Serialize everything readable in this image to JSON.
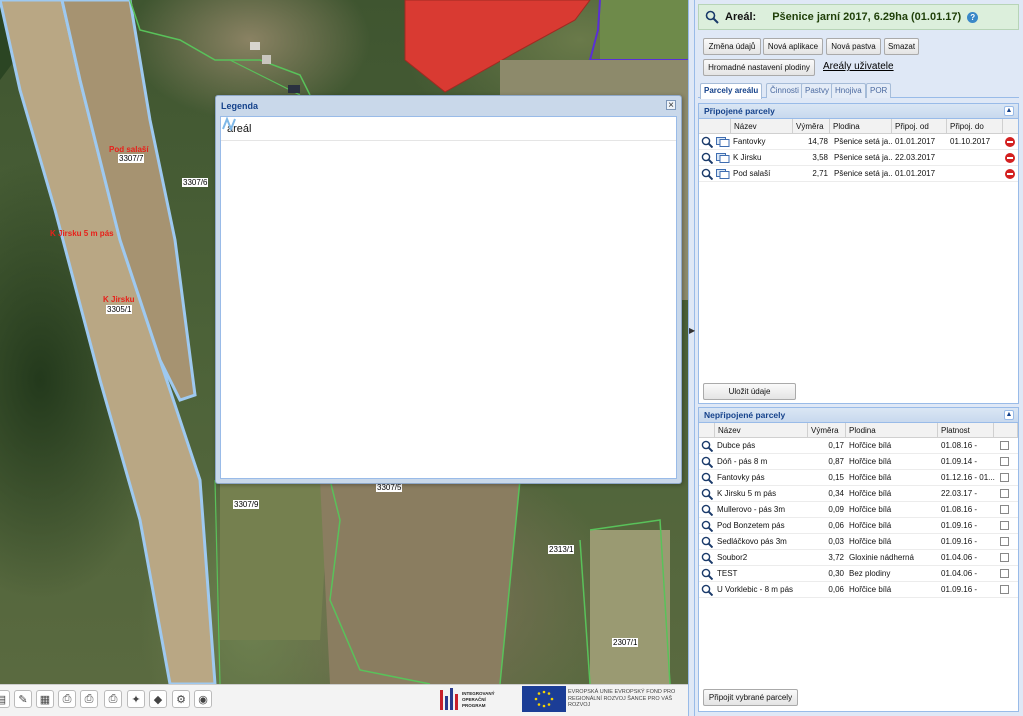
{
  "map": {
    "parcel_labels": [
      {
        "text": "Pod salaší"
      },
      {
        "text": "K Jirsku 5 m pás"
      },
      {
        "text": "K Jirsku"
      }
    ],
    "parcel_numbers": [
      "3307/7",
      "3307/6",
      "3305/1",
      "3307/9",
      "3307/5",
      "2313/1",
      "2307/1"
    ],
    "colors": {
      "red_area": "#d93a32",
      "parcel_outline": "#9ec9f0",
      "green_outline": "#59c25a",
      "purple_outline": "#5a2fd6"
    }
  },
  "legend": {
    "title": "Legenda",
    "close_icon": "close-icon",
    "items": [
      {
        "label": "areál",
        "icon": "areal-line-icon"
      }
    ]
  },
  "toolbar": {
    "icons": [
      "print-icon",
      "edit-icon",
      "layers-icon",
      "print-icon",
      "print-icon",
      "print-icon",
      "wizard-icon",
      "color-icon",
      "gear-icon",
      "eye-icon"
    ]
  },
  "logos": {
    "iop_text": "INTEGROVANÝ OPERAČNÍ PROGRAM",
    "eu_text": "EVROPSKÁ UNIE EVROPSKÝ FOND PRO REGIONÁLNÍ ROZVOJ ŠANCE PRO VÁŠ ROZVOJ"
  },
  "panel": {
    "header": {
      "label": "Areál:",
      "value": "Pšenice jarní 2017, 6.29ha (01.01.17)"
    },
    "buttons": {
      "change": "Změna údajů",
      "new_app": "Nová aplikace",
      "new_pastva": "Nová pastva",
      "delete": "Smazat",
      "bulk": "Hromadné nastavení plodiny",
      "arealy_link": "Areály uživatele"
    },
    "tabs": [
      "Parcely areálu",
      "Činnosti",
      "Pastvy",
      "Hnojiva",
      "POR"
    ],
    "active_tab": "Parcely areálu",
    "attached": {
      "title": "Připojené parcely",
      "columns": [
        "Název",
        "Výměra",
        "Plodina",
        "Připoj. od",
        "Připoj. do"
      ],
      "rows": [
        {
          "name": "Fantovky",
          "area": "14,78",
          "crop": "Pšenice setá ja...",
          "from": "01.01.2017",
          "to": "01.10.2017"
        },
        {
          "name": "K Jirsku",
          "area": "3,58",
          "crop": "Pšenice setá ja...",
          "from": "22.03.2017",
          "to": ""
        },
        {
          "name": "Pod salaší",
          "area": "2,71",
          "crop": "Pšenice setá ja...",
          "from": "01.01.2017",
          "to": ""
        }
      ],
      "save_label": "Uložit údaje"
    },
    "unattached": {
      "title": "Nepřipojené parcely",
      "columns": [
        "Název",
        "Výměra",
        "Plodina",
        "Platnost"
      ],
      "rows": [
        {
          "name": "Dubce pás",
          "area": "0,17",
          "crop": "Hořčice bílá",
          "valid": "01.08.16 -"
        },
        {
          "name": "Dóň - pás 8 m",
          "area": "0,87",
          "crop": "Hořčice bílá",
          "valid": "01.09.14 -"
        },
        {
          "name": "Fantovky pás",
          "area": "0,15",
          "crop": "Hořčice bílá",
          "valid": "01.12.16 - 01..."
        },
        {
          "name": "K Jirsku 5 m pás",
          "area": "0,34",
          "crop": "Hořčice bílá",
          "valid": "22.03.17 -"
        },
        {
          "name": "Mullerovo - pás 3m",
          "area": "0,09",
          "crop": "Hořčice bílá",
          "valid": "01.08.16 -"
        },
        {
          "name": "Pod Bonzetem pás",
          "area": "0,06",
          "crop": "Hořčice bílá",
          "valid": "01.09.16 -"
        },
        {
          "name": "Sedláčkovo pás 3m",
          "area": "0,03",
          "crop": "Hořčice bílá",
          "valid": "01.09.16 -"
        },
        {
          "name": "Soubor2",
          "area": "3,72",
          "crop": "Gloxinie nádherná",
          "valid": "01.04.06 -"
        },
        {
          "name": "TEST",
          "area": "0,30",
          "crop": "Bez plodiny",
          "valid": "01.04.06 -"
        },
        {
          "name": "U Vorklebic - 8 m pás",
          "area": "0,06",
          "crop": "Hořčice bílá",
          "valid": "01.09.16 -"
        }
      ],
      "connect_label": "Připojit vybrané parcely"
    }
  }
}
